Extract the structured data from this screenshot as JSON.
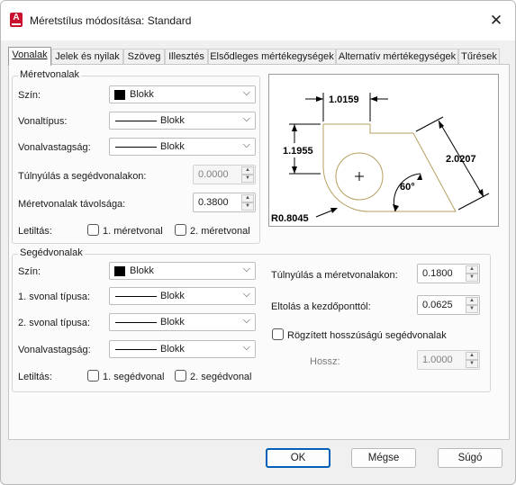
{
  "window": {
    "title": "Méretstílus módosítása: Standard"
  },
  "app_icon": {
    "letter": "A"
  },
  "tabs": [
    {
      "label": "Vonalak"
    },
    {
      "label": "Jelek és nyilak"
    },
    {
      "label": "Szöveg"
    },
    {
      "label": "Illesztés"
    },
    {
      "label": "Elsődleges mértékegységek"
    },
    {
      "label": "Alternatív mértékegységek"
    },
    {
      "label": "Tűrések"
    }
  ],
  "dim_lines": {
    "title": "Méretvonalak",
    "color_label": "Szín:",
    "color_value": "Blokk",
    "linetype_label": "Vonaltípus:",
    "linetype_value": "Blokk",
    "lineweight_label": "Vonalvastagság:",
    "lineweight_value": "Blokk",
    "extend_label": "Túlnyúlás a segédvonalakon:",
    "extend_value": "0.0000",
    "baseline_label": "Méretvonalak távolsága:",
    "baseline_value": "0.3800",
    "suppress_label": "Letiltás:",
    "suppress_1": "1. méretvonal",
    "suppress_2": "2. méretvonal"
  },
  "ext_lines": {
    "title": "Segédvonalak",
    "color_label": "Szín:",
    "color_value": "Blokk",
    "linetype1_label": "1. svonal típusa:",
    "linetype1_value": "Blokk",
    "linetype2_label": "2. svonal típusa:",
    "linetype2_value": "Blokk",
    "lineweight_label": "Vonalvastagság:",
    "lineweight_value": "Blokk",
    "suppress_label": "Letiltás:",
    "suppress_1": "1. segédvonal",
    "suppress_2": "2. segédvonal",
    "extend_beyond_label": "Túlnyúlás a méretvonalakon:",
    "extend_beyond_value": "0.1800",
    "offset_label": "Eltolás a kezdőponttól:",
    "offset_value": "0.0625",
    "fixed_length_label": "Rögzített hosszúságú segédvonalak",
    "length_label": "Hossz:",
    "length_value": "1.0000"
  },
  "preview": {
    "top_dim": "1.0159",
    "left_dim": "1.1955",
    "right_dim": "2.0207",
    "angle": "60°",
    "radius": "R0.8045"
  },
  "buttons": {
    "ok": "OK",
    "cancel": "Mégse",
    "help": "Súgó"
  },
  "colors": {
    "accent": "#005fb8",
    "shape": "#b5a060",
    "icon_red": "#c8102e"
  }
}
